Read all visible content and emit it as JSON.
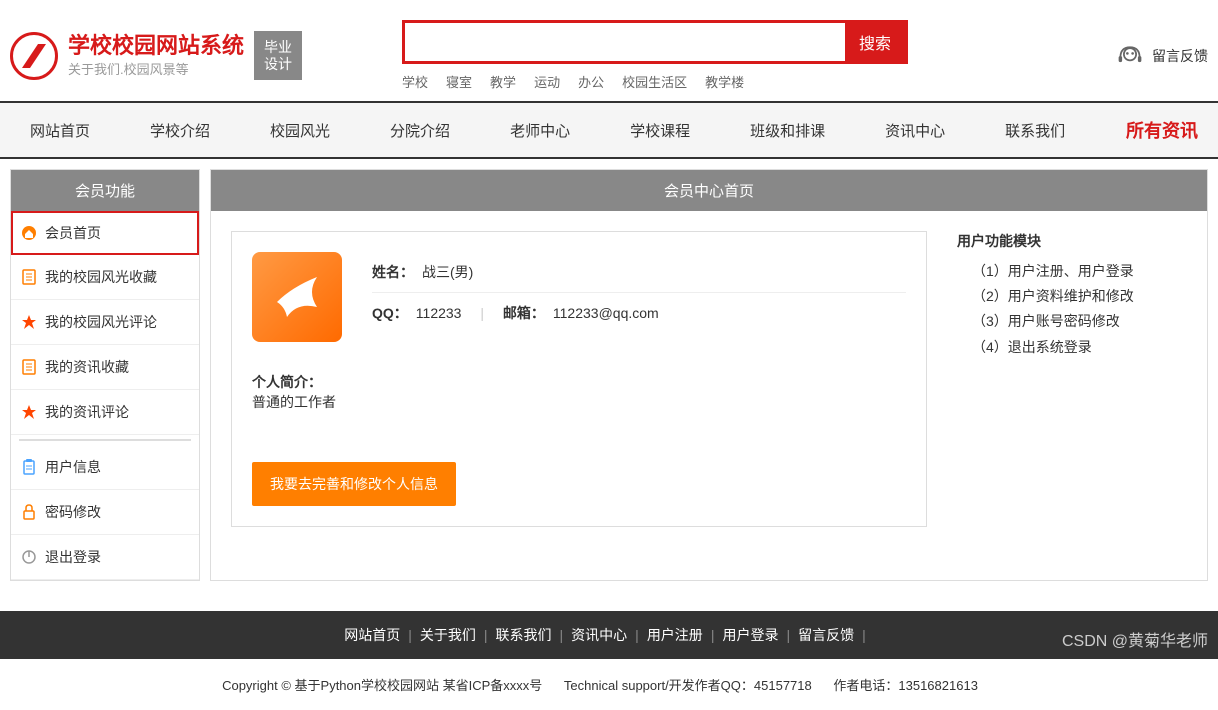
{
  "header": {
    "site_title": "学校校园网站系统",
    "site_subtitle": "关于我们.校园风景等",
    "grad_badge_l1": "毕业",
    "grad_badge_l2": "设计",
    "search_button": "搜索",
    "search_tags": [
      "学校",
      "寝室",
      "教学",
      "运动",
      "办公",
      "校园生活区",
      "教学楼"
    ],
    "feedback": "留言反馈"
  },
  "nav": {
    "items": [
      "网站首页",
      "学校介绍",
      "校园风光",
      "分院介绍",
      "老师中心",
      "学校课程",
      "班级和排课",
      "资讯中心",
      "联系我们"
    ],
    "right": "所有资讯"
  },
  "sidebar": {
    "title": "会员功能",
    "items": [
      {
        "label": "会员首页",
        "icon": "home-icon",
        "color": "#ff7f00",
        "active": true
      },
      {
        "label": "我的校园风光收藏",
        "icon": "doc-icon",
        "color": "#ff7f00"
      },
      {
        "label": "我的校园风光评论",
        "icon": "star-icon",
        "color": "#ff4500"
      },
      {
        "label": "我的资讯收藏",
        "icon": "doc-icon",
        "color": "#ff7f00"
      },
      {
        "label": "我的资讯评论",
        "icon": "star-icon",
        "color": "#ff4500"
      }
    ],
    "items2": [
      {
        "label": "用户信息",
        "icon": "clipboard-icon",
        "color": "#4aa3ff"
      },
      {
        "label": "密码修改",
        "icon": "lock-icon",
        "color": "#ff7f00"
      },
      {
        "label": "退出登录",
        "icon": "power-icon",
        "color": "#999"
      }
    ]
  },
  "content": {
    "title": "会员中心首页",
    "name_label": "姓名：",
    "name_value": "战三(男)",
    "qq_label": "QQ：",
    "qq_value": "112233",
    "email_label": "邮箱：",
    "email_value": "112233@qq.com",
    "bio_label": "个人简介：",
    "bio_value": "普通的工作者",
    "edit_button": "我要去完善和修改个人信息",
    "module_title": "用户功能模块",
    "module_items": [
      "（1）用户注册、用户登录",
      "（2）用户资料维护和修改",
      "（3）用户账号密码修改",
      "（4）退出系统登录"
    ]
  },
  "footer_nav": [
    "网站首页",
    "关于我们",
    "联系我们",
    "资讯中心",
    "用户注册",
    "用户登录",
    "留言反馈"
  ],
  "footer": {
    "copyright": "Copyright © 基于Python学校校园网站 某省ICP备xxxx号",
    "tech": "Technical support/开发作者QQ：45157718",
    "phone": "作者电话：13516821613"
  },
  "watermark": "CSDN @黄菊华老师"
}
